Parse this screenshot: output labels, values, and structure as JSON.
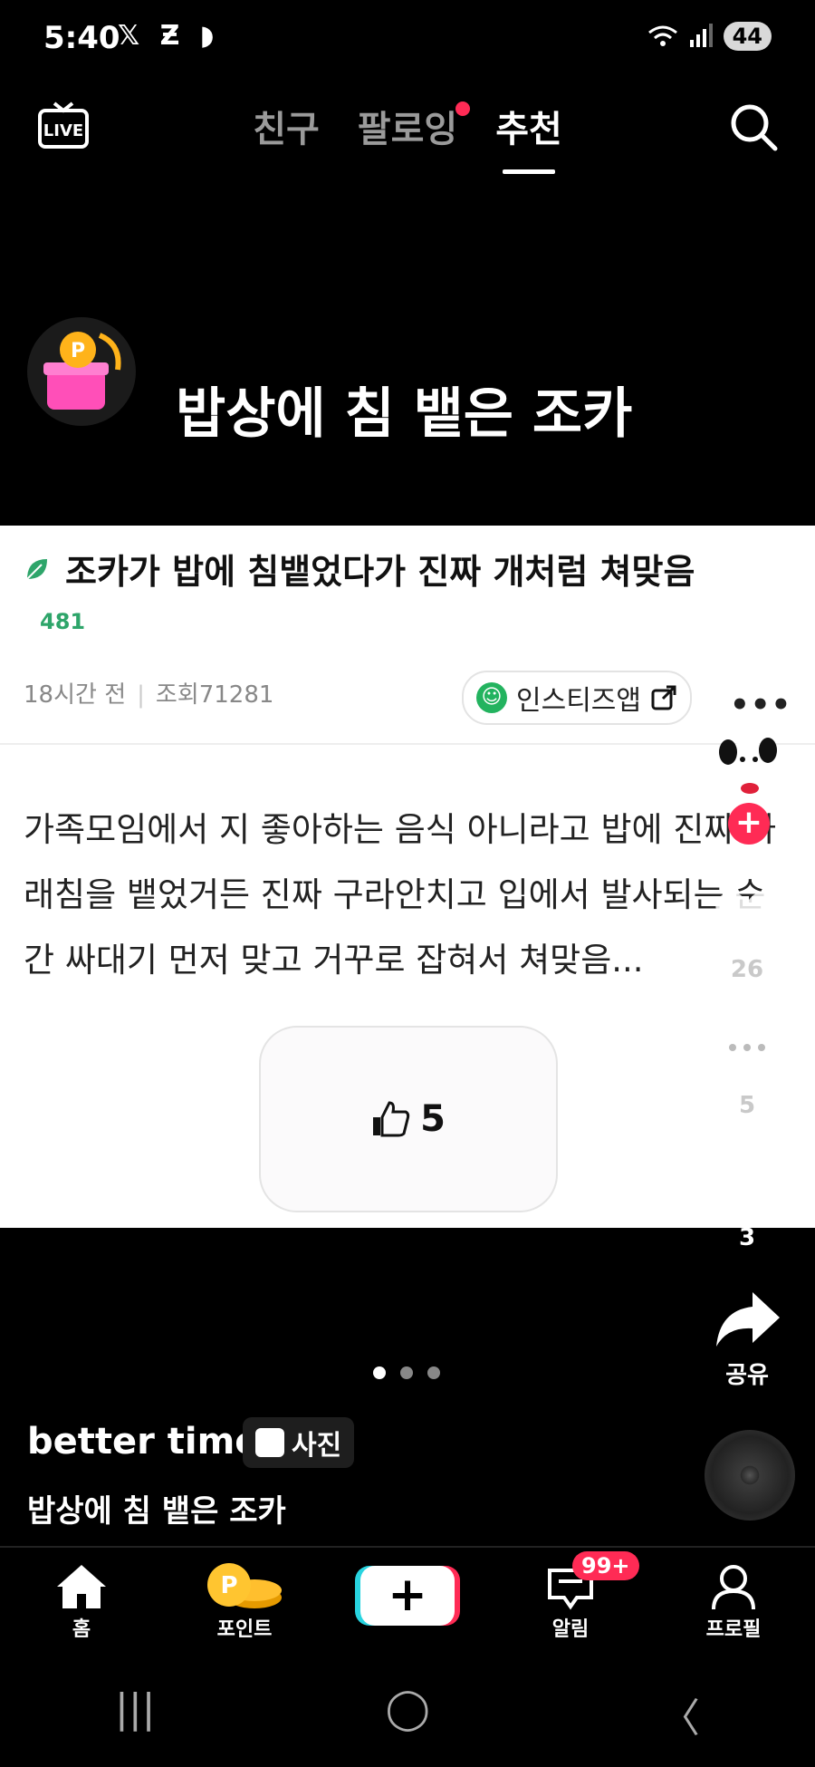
{
  "status": {
    "time": "5:40",
    "battery": "44",
    "app_icons": "𝕏 Ƶ ◗"
  },
  "top_nav": {
    "tabs": [
      {
        "label": "친구"
      },
      {
        "label": "팔로잉"
      },
      {
        "label": "추천"
      }
    ]
  },
  "overlay_title": "밥상에 침 뱉은 조카",
  "post": {
    "title": "조카가 밥에 침뱉었다가 진짜 개처럼 쳐맞음",
    "count": "481",
    "time_ago": "18시간 전",
    "views": "조회71281",
    "source": "인스티즈앱",
    "body": "가족모임에서 지 좋아하는 음식 아니라고 밥에 진짜 가래침을 뱉었거든 진짜 구라안치고 입에서 발사되는 순간 싸대기 먼저 맞고 거꾸로 잡혀서 쳐맞음...",
    "likes": "5"
  },
  "rail": {
    "likes": "26",
    "comments": "5",
    "bookmarks": "3",
    "share_label": "공유"
  },
  "caption": {
    "author": "better time",
    "type_chip": "사진",
    "text": "밥상에 침 뱉은 조카"
  },
  "bottom_nav": {
    "home": "홈",
    "points": "포인트",
    "create": "+",
    "alerts": "알림",
    "alerts_badge": "99+",
    "profile": "프로필"
  },
  "colors": {
    "accent": "#ff2b55",
    "teal": "#28d4e0",
    "green": "#2ea56a"
  }
}
